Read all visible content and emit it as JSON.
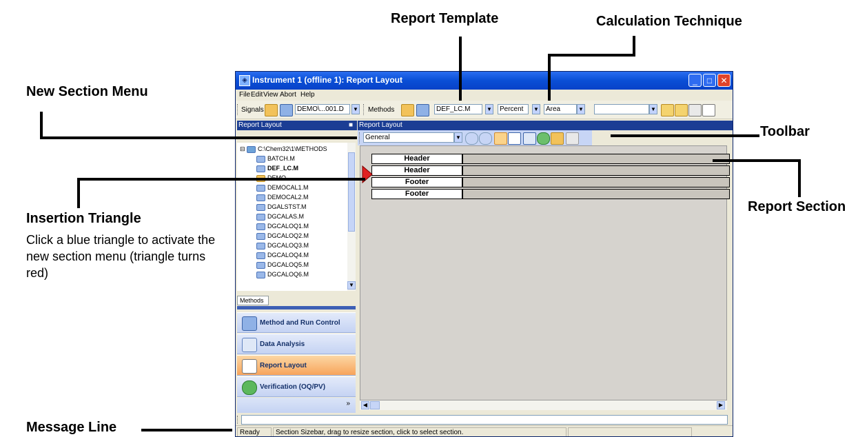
{
  "annotations": {
    "report_template": "Report Template",
    "calculation_technique": "Calculation Technique",
    "new_section_menu": "New Section Menu",
    "toolbar": "Toolbar",
    "insertion_triangle": "Insertion Triangle",
    "insertion_triangle_desc": "Click a blue triangle to activate the new section menu (triangle turns red)",
    "report_section": "Report Section",
    "message_line": "Message Line"
  },
  "window": {
    "title": "Instrument 1 (offline 1): Report Layout",
    "menu": [
      "File",
      "Edit",
      "View",
      "Abort",
      "Help"
    ]
  },
  "toolbar": {
    "signals_label": "Signals",
    "signals_value": "DEMO\\...001.D",
    "methods_label": "Methods",
    "method_value": "DEF_LC.M",
    "calc_value": "Percent",
    "based_on_value": "Area",
    "blank_value": ""
  },
  "left_pane": {
    "header": "Report Layout",
    "pin": "■",
    "tree_root": "C:\\Chem32\\1\\METHODS",
    "tree_items": [
      "BATCH.M",
      "DEF_LC.M",
      "DEMO",
      "DEMOCAL1.M",
      "DEMOCAL2.M",
      "DGALSTST.M",
      "DGCALAS.M",
      "DGCALOQ1.M",
      "DGCALOQ2.M",
      "DGCALOQ3.M",
      "DGCALOQ4.M",
      "DGCALOQ5.M",
      "DGCALOQ6.M"
    ],
    "tab_label": "Methods",
    "nav_buttons": [
      "Method and Run Control",
      "Data Analysis",
      "Report Layout",
      "Verification (OQ/PV)"
    ],
    "active_nav": "Report Layout"
  },
  "right_pane": {
    "header": "Report Layout",
    "section_type": "General",
    "sections": [
      "Header",
      "Header",
      "Footer",
      "Footer"
    ]
  },
  "status": {
    "state": "Ready",
    "message": "Section Sizebar, drag to resize section, click to select section."
  },
  "colors": {
    "titlebar": "#0a4fd6",
    "active_nav": "#f7a45b",
    "insertion_triangle": "#e02020"
  }
}
